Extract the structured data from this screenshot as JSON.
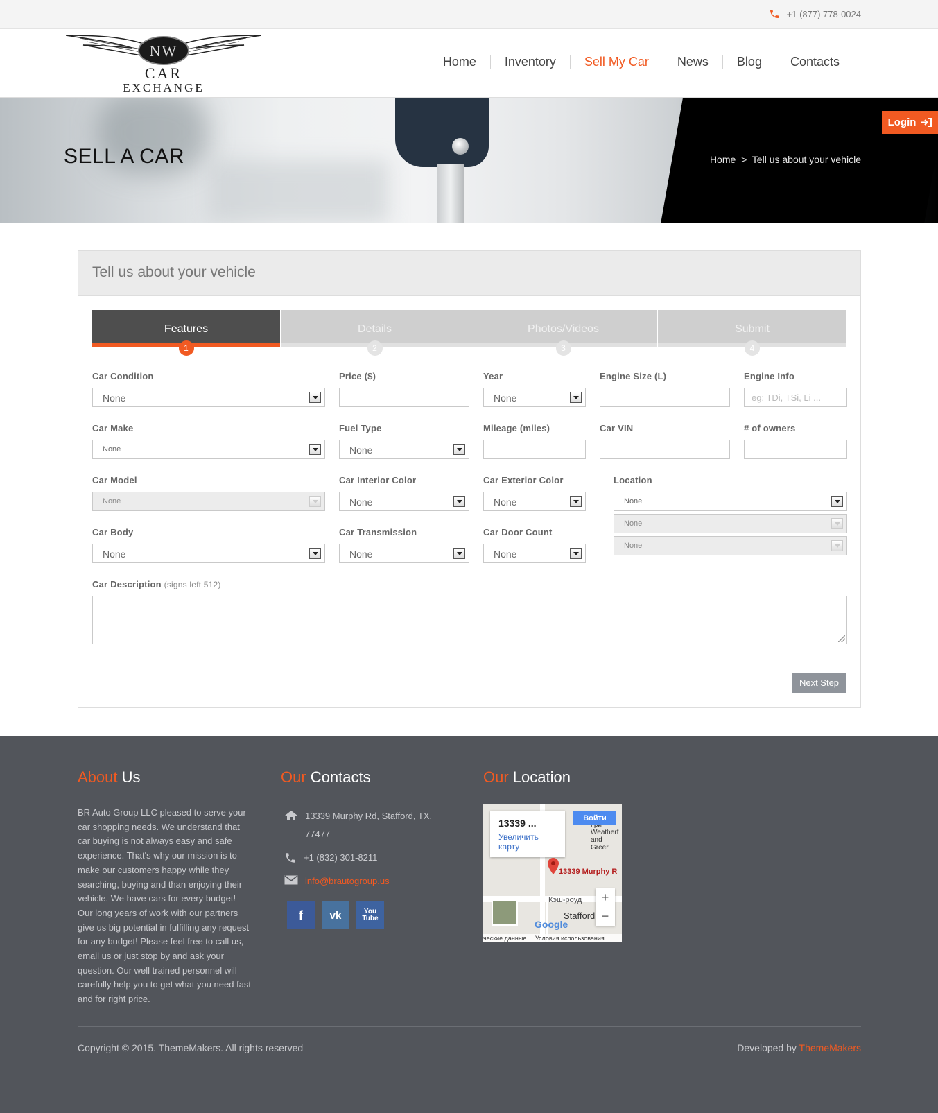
{
  "topbar": {
    "phone": "+1 (877) 778-0024"
  },
  "logo": {
    "badge": "NW",
    "line1": "CAR",
    "line2": "EXCHANGE"
  },
  "nav": {
    "items": [
      "Home",
      "Inventory",
      "Sell My Car",
      "News",
      "Blog",
      "Contacts"
    ],
    "active": "Sell My Car"
  },
  "hero": {
    "title": "SELL A CAR",
    "breadcrumb_home": "Home",
    "breadcrumb_sep": ">",
    "breadcrumb_current": "Tell us about your vehicle"
  },
  "login": {
    "label": "Login"
  },
  "panel": {
    "title": "Tell us about your vehicle"
  },
  "steps": [
    {
      "label": "Features",
      "num": "1"
    },
    {
      "label": "Details",
      "num": "2"
    },
    {
      "label": "Photos/Videos",
      "num": "3"
    },
    {
      "label": "Submit",
      "num": "4"
    }
  ],
  "form": {
    "car_condition": {
      "label": "Car Condition",
      "value": "None"
    },
    "price": {
      "label": "Price ($)"
    },
    "year": {
      "label": "Year",
      "value": "None"
    },
    "engine_size": {
      "label": "Engine Size (L)"
    },
    "engine_info": {
      "label": "Engine Info",
      "placeholder": "eg: TDi, TSi, Li ..."
    },
    "car_make": {
      "label": "Car Make",
      "value": "None"
    },
    "fuel_type": {
      "label": "Fuel Type",
      "value": "None"
    },
    "mileage": {
      "label": "Mileage (miles)"
    },
    "car_vin": {
      "label": "Car VIN"
    },
    "owners": {
      "label": "# of owners"
    },
    "car_model": {
      "label": "Car Model",
      "value": "None"
    },
    "interior_color": {
      "label": "Car Interior Color",
      "value": "None"
    },
    "exterior_color": {
      "label": "Car Exterior Color",
      "value": "None"
    },
    "location": {
      "label": "Location",
      "values": [
        "None",
        "None",
        "None"
      ]
    },
    "car_body": {
      "label": "Car Body",
      "value": "None"
    },
    "transmission": {
      "label": "Car Transmission",
      "value": "None"
    },
    "door_count": {
      "label": "Car Door Count",
      "value": "None"
    },
    "description": {
      "label": "Car Description",
      "hint": "(signs left 512)"
    },
    "next_button": "Next Step"
  },
  "footer": {
    "about": {
      "hl": "About",
      "rest": " Us",
      "text": "BR Auto Group LLC pleased to serve your car shopping needs. We understand that car buying is not always easy and safe experience. That's why our mission is to make our customers happy while they searching, buying and than enjoying their vehicle. We have cars for every budget! Our long years of work with our partners give us big potential in fulfilling any request for any budget! Please feel free to call us, email us or just stop by and ask your question. Our well trained personnel will carefully help you to get what you need fast and for right price."
    },
    "contacts": {
      "hl": "Our",
      "rest": " Contacts",
      "address": "13339 Murphy Rd, Stafford, TX, 77477",
      "phone": "+1 (832) 301-8211",
      "email": "info@brautogroup.us"
    },
    "location": {
      "hl": "Our",
      "rest": " Location"
    },
    "map": {
      "card_title": "13339 ...",
      "card_link": "Увеличить карту",
      "signin": "Войти",
      "pin_label": "13339 Murphy R",
      "street": "Кэш-роуд",
      "town": "Stafford",
      "side_text": "ф ЗНД Гри Weatherf and Greer",
      "bottom_left": "ческие данные",
      "bottom_right": "Условия использования",
      "logo": "Google"
    },
    "copyright": "Copyright © 2015. ThemeMakers. All rights reserved",
    "developed_prefix": "Developed by ",
    "developed_brand": "ThemeMakers"
  },
  "colors": {
    "accent": "#f15a22",
    "footer_bg": "#52555b",
    "step_active": "#4e4e4e"
  },
  "icons": [
    "phone-icon",
    "login-icon",
    "home-icon",
    "envelope-icon",
    "facebook-icon",
    "vk-icon",
    "youtube-icon"
  ]
}
